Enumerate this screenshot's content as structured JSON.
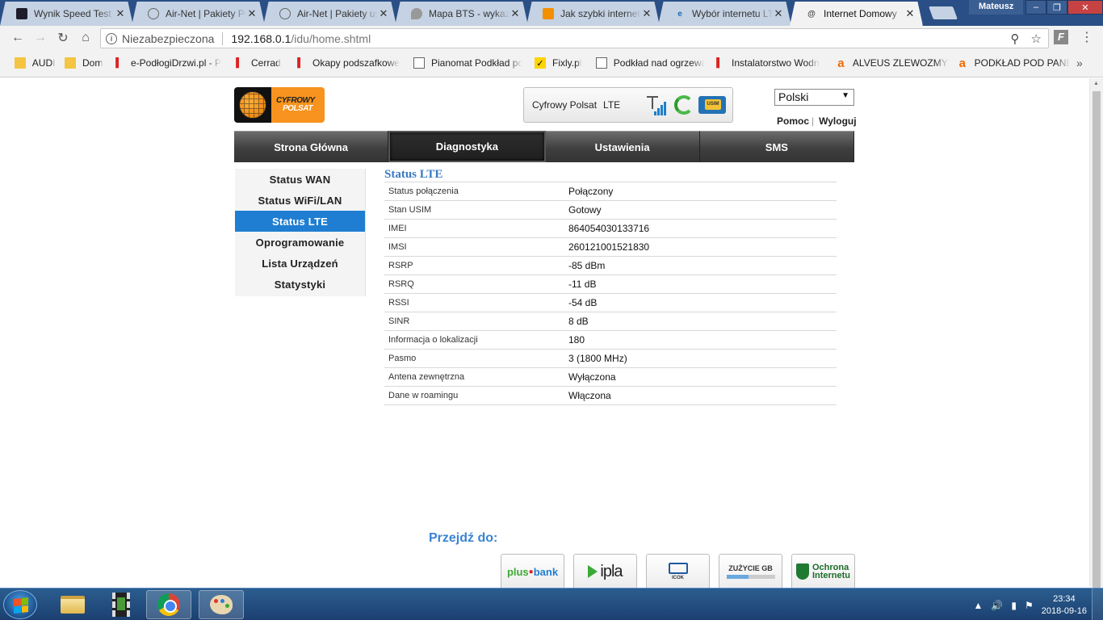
{
  "browser": {
    "tabs": [
      {
        "title": "Wynik Speed Test -",
        "icon": "speedtest-icon"
      },
      {
        "title": "Air-Net | Pakiety Po",
        "icon": "globe-icon"
      },
      {
        "title": "Air-Net | Pakiety us",
        "icon": "globe-icon"
      },
      {
        "title": "Mapa BTS - wykaz",
        "icon": "pin-icon"
      },
      {
        "title": "Jak szybki internet",
        "icon": "orange-favicon"
      },
      {
        "title": "Wybór internetu LT",
        "icon": "edge-icon"
      },
      {
        "title": "Internet Domowy",
        "icon": "at-icon"
      }
    ],
    "user": "Mateusz",
    "security_label": "Niezabezpieczona",
    "url_host": "192.168.0.1",
    "url_path": "/idu/home.shtml",
    "bookmarks": [
      {
        "label": "AUDI",
        "icon": "folder"
      },
      {
        "label": "Dom",
        "icon": "folder"
      },
      {
        "label": "e-PodłogiDrzwi.pl - P",
        "icon": "site"
      },
      {
        "label": "Cerrad",
        "icon": "site"
      },
      {
        "label": "Okapy podszafkowe",
        "icon": "site"
      },
      {
        "label": "Pianomat Podkład pc",
        "icon": "doc"
      },
      {
        "label": "Fixly.pl",
        "icon": "check"
      },
      {
        "label": "Podkład nad ogrzewa",
        "icon": "doc"
      },
      {
        "label": "Instalatorstwo Wodn",
        "icon": "site"
      },
      {
        "label": "ALVEUS ZLEWOZMYW",
        "icon": "allegro"
      },
      {
        "label": "PODKŁAD POD PANE",
        "icon": "allegro"
      }
    ]
  },
  "router": {
    "logo_text": [
      "CYFROWY",
      "POLSAT"
    ],
    "operator": "Cyfrowy Polsat",
    "network_type": "LTE",
    "signal_strength_bars": 4,
    "sim_label": "USIM",
    "language": "Polski",
    "help_link": "Pomoc",
    "logout_link": "Wyloguj",
    "main_nav": [
      {
        "label": "Strona Główna",
        "active": false
      },
      {
        "label": "Diagnostyka",
        "active": true
      },
      {
        "label": "Ustawienia",
        "active": false
      },
      {
        "label": "SMS",
        "active": false
      }
    ],
    "side_nav": [
      {
        "label": "Status WAN",
        "active": false
      },
      {
        "label": "Status WiFi/LAN",
        "active": false
      },
      {
        "label": "Status LTE",
        "active": true
      },
      {
        "label": "Oprogramowanie",
        "active": false
      },
      {
        "label": "Lista Urządzeń",
        "active": false
      },
      {
        "label": "Statystyki",
        "active": false
      }
    ],
    "section_title": "Status LTE",
    "lte_rows": [
      {
        "key": "Status połączenia",
        "value": "Połączony"
      },
      {
        "key": "Stan USIM",
        "value": "Gotowy"
      },
      {
        "key": "IMEI",
        "value": "864054030133716"
      },
      {
        "key": "IMSI",
        "value": "260121001521830"
      },
      {
        "key": "RSRP",
        "value": "-85 dBm"
      },
      {
        "key": "RSRQ",
        "value": "-11 dB"
      },
      {
        "key": "RSSI",
        "value": "-54 dB"
      },
      {
        "key": "SINR",
        "value": "8 dB"
      },
      {
        "key": "Informacja o lokalizacji",
        "value": "180"
      },
      {
        "key": "Pasmo",
        "value": "3 (1800 MHz)"
      },
      {
        "key": "Antena zewnętrzna",
        "value": "Wyłączona"
      },
      {
        "key": "Dane w roamingu",
        "value": "Włączona"
      }
    ],
    "goto_label": "Przejdź do:",
    "partners": {
      "plusbank": [
        "plus",
        "bank"
      ],
      "ipla": "ipla",
      "icok": "ICOK",
      "gb": "ZUŻYCIE GB",
      "ochrona": [
        "Ochrona",
        "Internetu"
      ]
    },
    "gb_usage_fraction": 0.45
  },
  "taskbar": {
    "time": "23:34",
    "date": "2018-09-16"
  }
}
